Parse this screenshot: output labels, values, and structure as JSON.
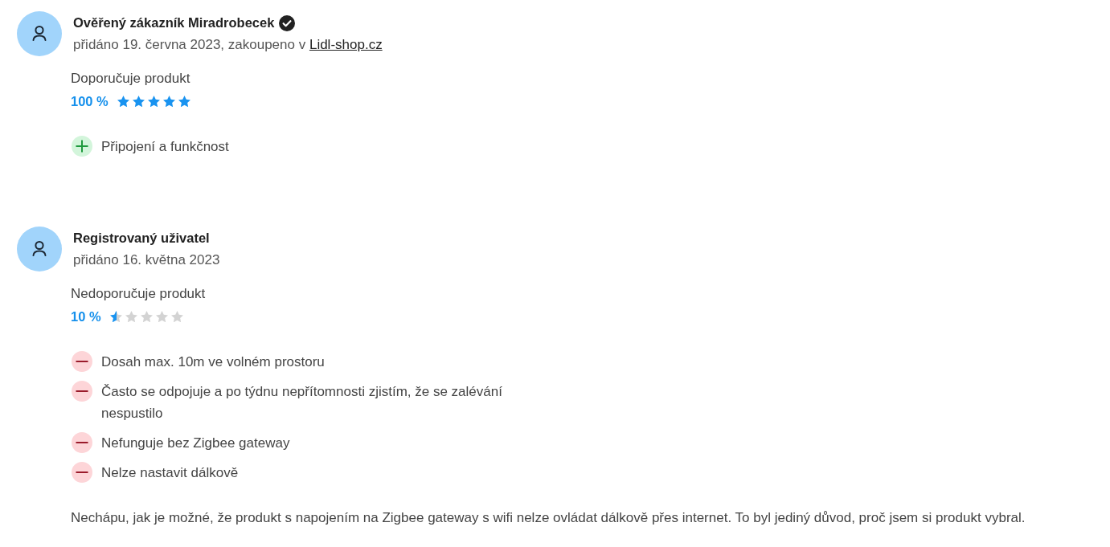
{
  "reviews": [
    {
      "author": "Ověřený zákazník Miradrobecek",
      "verified": true,
      "date": "přidáno 19. června 2023, zakoupeno v",
      "shop_link": "Lidl-shop.cz",
      "recommendation": "Doporučuje produkt",
      "percent": "100 %",
      "stars": 5,
      "points": [
        {
          "kind": "pro",
          "text": "Připojení a funkčnost"
        }
      ]
    },
    {
      "author": "Registrovaný uživatel",
      "verified": false,
      "date": "přidáno 16. května 2023",
      "recommendation": "Nedoporučuje produkt",
      "percent": "10 %",
      "stars": 0.5,
      "points": [
        {
          "kind": "con",
          "text": "Dosah max. 10m ve volném prostoru"
        },
        {
          "kind": "con",
          "text": "Často se odpojuje a po týdnu nepřítomnosti zjistím, že se zalévání nespustilo"
        },
        {
          "kind": "con",
          "text": "Nefunguje bez Zigbee gateway"
        },
        {
          "kind": "con",
          "text": "Nelze nastavit dálkově"
        }
      ],
      "comment": "Nechápu, jak je možné, že produkt s napojením na Zigbee gateway s wifi nelze ovládat dálkově přes internet. To byl jediný důvod, proč jsem si produkt vybral."
    }
  ]
}
